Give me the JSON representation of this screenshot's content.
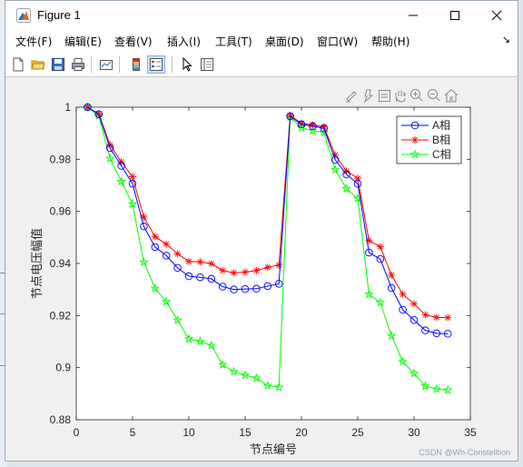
{
  "window": {
    "title": "Figure 1"
  },
  "menu": {
    "items": [
      "文件(F)",
      "编辑(E)",
      "查看(V)",
      "插入(I)",
      "工具(T)",
      "桌面(D)",
      "窗口(W)",
      "帮助(H)"
    ]
  },
  "toolbar": {
    "buttons": [
      "new-figure",
      "open-file",
      "save",
      "print",
      "link-plot",
      "insert-colorbar",
      "insert-legend",
      "edit-plot",
      "property-inspector"
    ]
  },
  "axes_toolbar": {
    "icons": [
      "brush-edit",
      "data-tips",
      "save-export",
      "pan-hand",
      "zoom-in",
      "zoom-out",
      "home-restore"
    ]
  },
  "chart_data": {
    "type": "line",
    "title": "",
    "xlabel": "节点编号",
    "ylabel": "节点电压幅值",
    "xlim": [
      0,
      35
    ],
    "ylim": [
      0.88,
      1.0
    ],
    "xticks": [
      "0",
      "5",
      "10",
      "15",
      "20",
      "25",
      "30",
      "35"
    ],
    "yticks": [
      "0.88",
      "0.9",
      "0.92",
      "0.94",
      "0.96",
      "0.98",
      "1"
    ],
    "legend_position": "top-right",
    "grid": false,
    "x": [
      1,
      2,
      3,
      4,
      5,
      6,
      7,
      8,
      9,
      10,
      11,
      12,
      13,
      14,
      15,
      16,
      17,
      18,
      19,
      20,
      21,
      22,
      23,
      24,
      25,
      26,
      27,
      28,
      29,
      30,
      31,
      32,
      33
    ],
    "series": [
      {
        "name": "A相",
        "color": "#0000ff",
        "marker": "circle",
        "values": [
          1.0,
          0.9973,
          0.9843,
          0.9775,
          0.9706,
          0.9542,
          0.9463,
          0.943,
          0.9383,
          0.9351,
          0.9347,
          0.9341,
          0.9311,
          0.93,
          0.9302,
          0.9303,
          0.9313,
          0.9322,
          0.9965,
          0.9934,
          0.9927,
          0.9919,
          0.9798,
          0.9742,
          0.9706,
          0.9442,
          0.9417,
          0.9306,
          0.9222,
          0.9183,
          0.9143,
          0.9132,
          0.913
        ]
      },
      {
        "name": "B相",
        "color": "#ff0000",
        "marker": "star",
        "values": [
          1.0,
          0.9975,
          0.9855,
          0.979,
          0.9733,
          0.9578,
          0.9503,
          0.9474,
          0.9437,
          0.9408,
          0.9406,
          0.9399,
          0.9373,
          0.9364,
          0.9367,
          0.9373,
          0.9385,
          0.9394,
          0.9969,
          0.9938,
          0.9932,
          0.9925,
          0.9816,
          0.9755,
          0.9727,
          0.9488,
          0.9464,
          0.9355,
          0.9282,
          0.9245,
          0.9203,
          0.9193,
          0.9192
        ]
      },
      {
        "name": "C相",
        "color": "#00ff00",
        "marker": "pentagram",
        "values": [
          1.0,
          0.9967,
          0.9803,
          0.9715,
          0.9628,
          0.9405,
          0.9304,
          0.9253,
          0.9182,
          0.911,
          0.9101,
          0.9085,
          0.9011,
          0.8985,
          0.8971,
          0.896,
          0.8931,
          0.8925,
          0.9962,
          0.9921,
          0.991,
          0.9903,
          0.976,
          0.9687,
          0.965,
          0.9282,
          0.925,
          0.9122,
          0.9023,
          0.8978,
          0.8929,
          0.8918,
          0.8914
        ]
      }
    ]
  },
  "watermark": "CSDN @Wh-Constelltion"
}
